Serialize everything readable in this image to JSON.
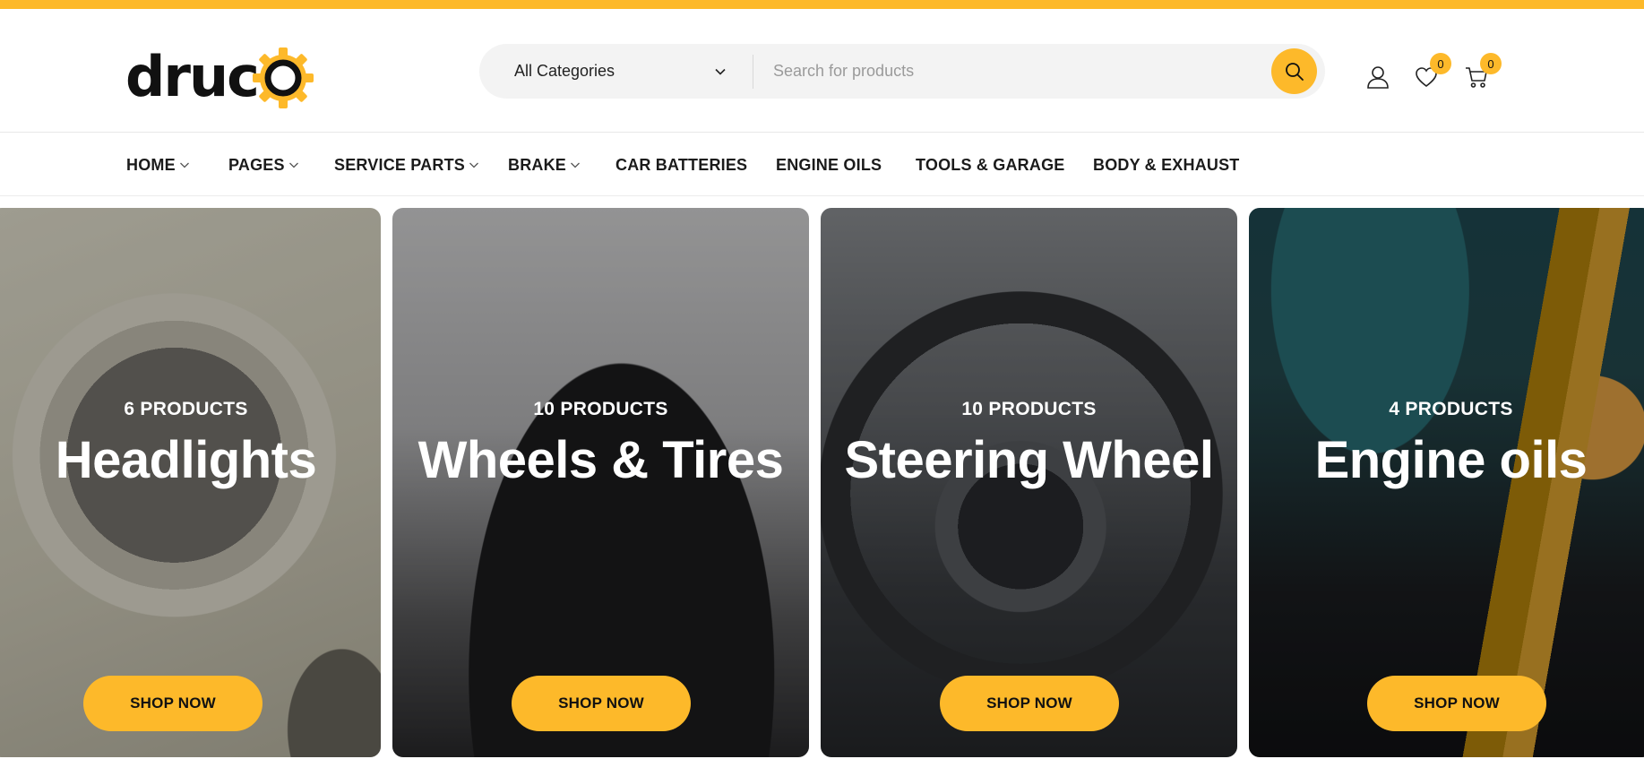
{
  "brand": {
    "logo_text": "druc",
    "logo_letter_o": "o",
    "accent": "#fdb92a"
  },
  "search": {
    "category_label": "All Categories",
    "placeholder": "Search for products",
    "value": ""
  },
  "header_icons": {
    "account_icon": "user-icon",
    "wishlist_icon": "heart-icon",
    "wishlist_count": "0",
    "cart_icon": "cart-icon",
    "cart_count": "0"
  },
  "nav": {
    "items": [
      {
        "label": "HOME",
        "has_dropdown": true
      },
      {
        "label": "PAGES",
        "has_dropdown": true
      },
      {
        "label": "SERVICE PARTS",
        "has_dropdown": true
      },
      {
        "label": "BRAKE",
        "has_dropdown": true
      },
      {
        "label": "CAR BATTERIES",
        "has_dropdown": false
      },
      {
        "label": "ENGINE OILS",
        "has_dropdown": false
      },
      {
        "label": "TOOLS & GARAGE",
        "has_dropdown": false
      },
      {
        "label": "BODY & EXHAUST",
        "has_dropdown": false
      }
    ]
  },
  "categories": [
    {
      "count": "6 PRODUCTS",
      "title": "Headlights",
      "button": "SHOP NOW"
    },
    {
      "count": "10 PRODUCTS",
      "title": "Wheels & Tires",
      "button": "SHOP NOW"
    },
    {
      "count": "10 PRODUCTS",
      "title": "Steering Wheel",
      "button": "SHOP NOW"
    },
    {
      "count": "4 PRODUCTS",
      "title": "Engine oils",
      "button": "SHOP NOW"
    }
  ]
}
